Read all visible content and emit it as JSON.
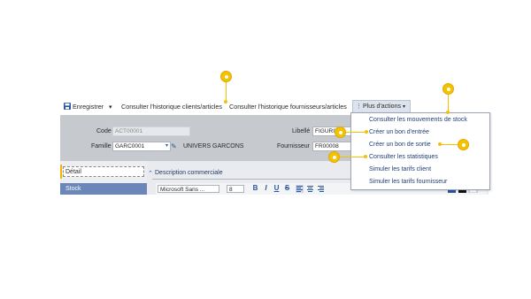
{
  "toolbar": {
    "save_label": "Enregistrer",
    "save_caret": "▾",
    "history_clients_label": "Consulter l'historique clients/articles",
    "history_suppliers_label": "Consulter l'historique fournisseurs/articles",
    "more_actions_label": "Plus d'actions",
    "more_actions_caret": "▾",
    "more_actions_dots": "⋮"
  },
  "form": {
    "code_label": "Code",
    "code_value": "ACT00001",
    "famille_label": "Famille",
    "famille_value": "GARC0001",
    "famille_desc": "UNIVERS GARCONS",
    "libelle_label": "Libellé",
    "libelle_value": "FIGURIN",
    "fournisseur_label": "Fournisseur",
    "fournisseur_value": "FR00008"
  },
  "tabs": {
    "detail": "Détail",
    "stock": "Stock"
  },
  "section": {
    "title": "Description commerciale",
    "toggle": "⌃"
  },
  "editor": {
    "font": "Microsoft Sans ...",
    "size": "8",
    "bold": "B",
    "italic": "I",
    "underline": "U",
    "strike": "S"
  },
  "menu": {
    "items": [
      "Consulter les mouvements de stock",
      "Créer un bon d'entrée",
      "Créer un bon de sortie",
      "Consulter les statistiques",
      "Simuler les tarifs client",
      "Simuler les tarifs fournisseur"
    ]
  },
  "colors": {
    "accent": "#f3c200",
    "form_bg": "#c6c9ce",
    "stock_tab": "#6b86b8",
    "menu_text": "#1d3e78"
  }
}
